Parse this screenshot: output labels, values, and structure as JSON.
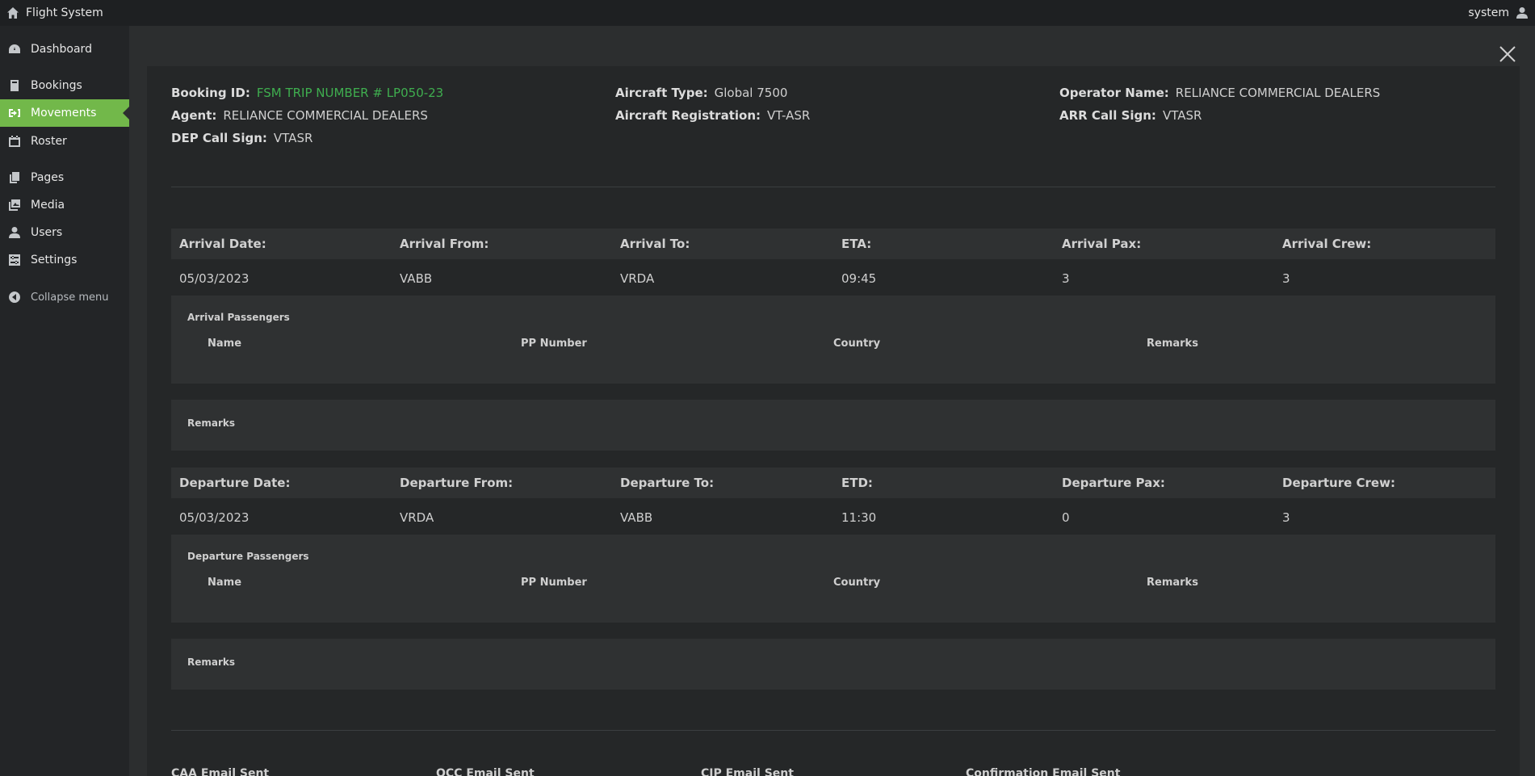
{
  "topbar": {
    "app_title": "Flight System",
    "user_name": "system"
  },
  "sidebar": {
    "items": [
      {
        "label": "Dashboard",
        "icon": "dashboard-icon"
      },
      {
        "label": "Bookings",
        "icon": "book-icon"
      },
      {
        "label": "Movements",
        "icon": "sign-in-icon",
        "active": true
      },
      {
        "label": "Roster",
        "icon": "calendar-icon"
      },
      {
        "label": "Pages",
        "icon": "pages-icon"
      },
      {
        "label": "Media",
        "icon": "media-icon"
      },
      {
        "label": "Users",
        "icon": "user-icon"
      },
      {
        "label": "Settings",
        "icon": "settings-icon"
      }
    ],
    "collapse_label": "Collapse menu"
  },
  "colors": {
    "accent": "#72b84a",
    "booking_id": "#3fae4f"
  },
  "booking": {
    "booking_id_label": "Booking ID:",
    "booking_id": "FSM TRIP NUMBER # LP050-23",
    "agent_label": "Agent:",
    "agent": "RELIANCE COMMERCIAL DEALERS",
    "dep_call_sign_label": "DEP Call Sign:",
    "dep_call_sign": "VTASR",
    "aircraft_type_label": "Aircraft Type:",
    "aircraft_type": "Global 7500",
    "aircraft_registration_label": "Aircraft Registration:",
    "aircraft_registration": "VT-ASR",
    "operator_name_label": "Operator Name:",
    "operator_name": "RELIANCE COMMERCIAL DEALERS",
    "arr_call_sign_label": "ARR Call Sign:",
    "arr_call_sign": "VTASR"
  },
  "arrival": {
    "headers": [
      "Arrival Date:",
      "Arrival From:",
      "Arrival To:",
      "ETA:",
      "Arrival Pax:",
      "Arrival Crew:"
    ],
    "values": [
      "05/03/2023",
      "VABB",
      "VRDA",
      "09:45",
      "3",
      "3"
    ],
    "passengers_title": "Arrival Passengers",
    "passenger_columns": [
      "Name",
      "PP Number",
      "Country",
      "Remarks"
    ],
    "remarks_title": "Remarks"
  },
  "departure": {
    "headers": [
      "Departure Date:",
      "Departure From:",
      "Departure To:",
      "ETD:",
      "Departure Pax:",
      "Departure Crew:"
    ],
    "values": [
      "05/03/2023",
      "VRDA",
      "VABB",
      "11:30",
      "0",
      "3"
    ],
    "passengers_title": "Departure Passengers",
    "passenger_columns": [
      "Name",
      "PP Number",
      "Country",
      "Remarks"
    ],
    "remarks_title": "Remarks"
  },
  "email_sections": [
    "CAA Email Sent",
    "OCC Email Sent",
    "CIP Email Sent",
    "Confirmation Email Sent"
  ]
}
